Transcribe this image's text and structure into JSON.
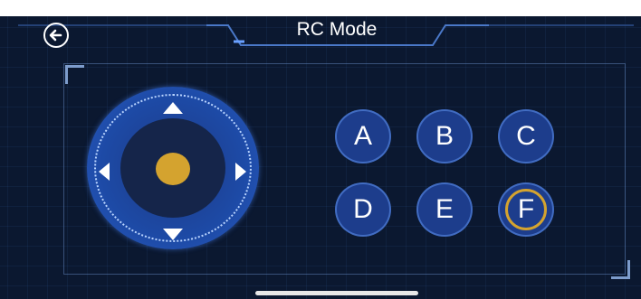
{
  "header": {
    "title": "RC Mode",
    "back_icon": "back-arrow-icon"
  },
  "joystick": {
    "arrows": [
      "up",
      "down",
      "left",
      "right"
    ],
    "knob_color": "#d4a32f"
  },
  "buttons": [
    {
      "label": "A",
      "selected": false
    },
    {
      "label": "B",
      "selected": false
    },
    {
      "label": "C",
      "selected": false
    },
    {
      "label": "D",
      "selected": false
    },
    {
      "label": "E",
      "selected": false
    },
    {
      "label": "F",
      "selected": true
    }
  ],
  "colors": {
    "background": "#0b1830",
    "button_fill": "#1d3d8c",
    "accent": "#d4a32f"
  }
}
